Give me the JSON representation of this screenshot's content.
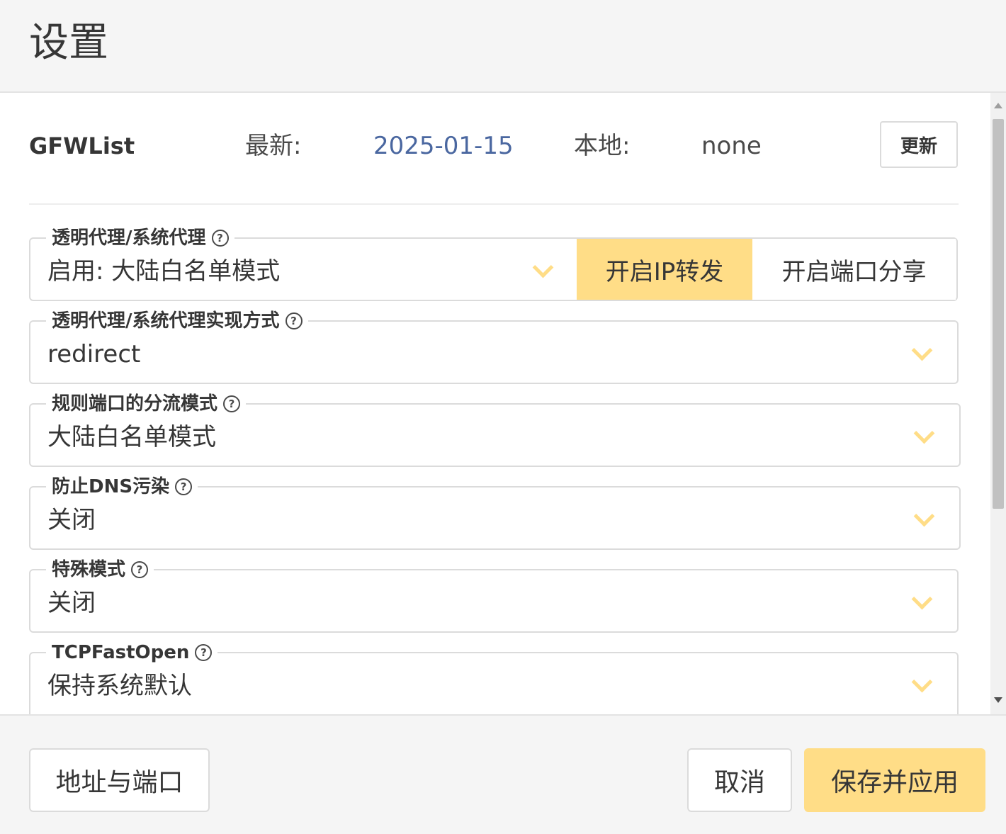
{
  "header": {
    "title": "设置"
  },
  "gfwlist": {
    "name": "GFWList",
    "latest_label": "最新:",
    "latest_value": "2025-01-15",
    "local_label": "本地:",
    "local_value": "none",
    "update_label": "更新"
  },
  "fields": [
    {
      "label": "透明代理/系统代理",
      "value": "启用: 大陆白名单模式",
      "buttons": [
        "开启IP转发",
        "开启端口分享"
      ]
    },
    {
      "label": "透明代理/系统代理实现方式",
      "value": "redirect"
    },
    {
      "label": "规则端口的分流模式",
      "value": "大陆白名单模式"
    },
    {
      "label": "防止DNS污染",
      "value": "关闭"
    },
    {
      "label": "特殊模式",
      "value": "关闭"
    },
    {
      "label": "TCPFastOpen",
      "value": "保持系统默认"
    }
  ],
  "help_glyph": "?",
  "footer": {
    "address_port_label": "地址与端口",
    "cancel_label": "取消",
    "save_apply_label": "保存并应用"
  },
  "colors": {
    "accent": "#ffdd87",
    "date_link": "#4a67a0",
    "border": "#dbdbdb",
    "background": "#f5f5f5"
  }
}
